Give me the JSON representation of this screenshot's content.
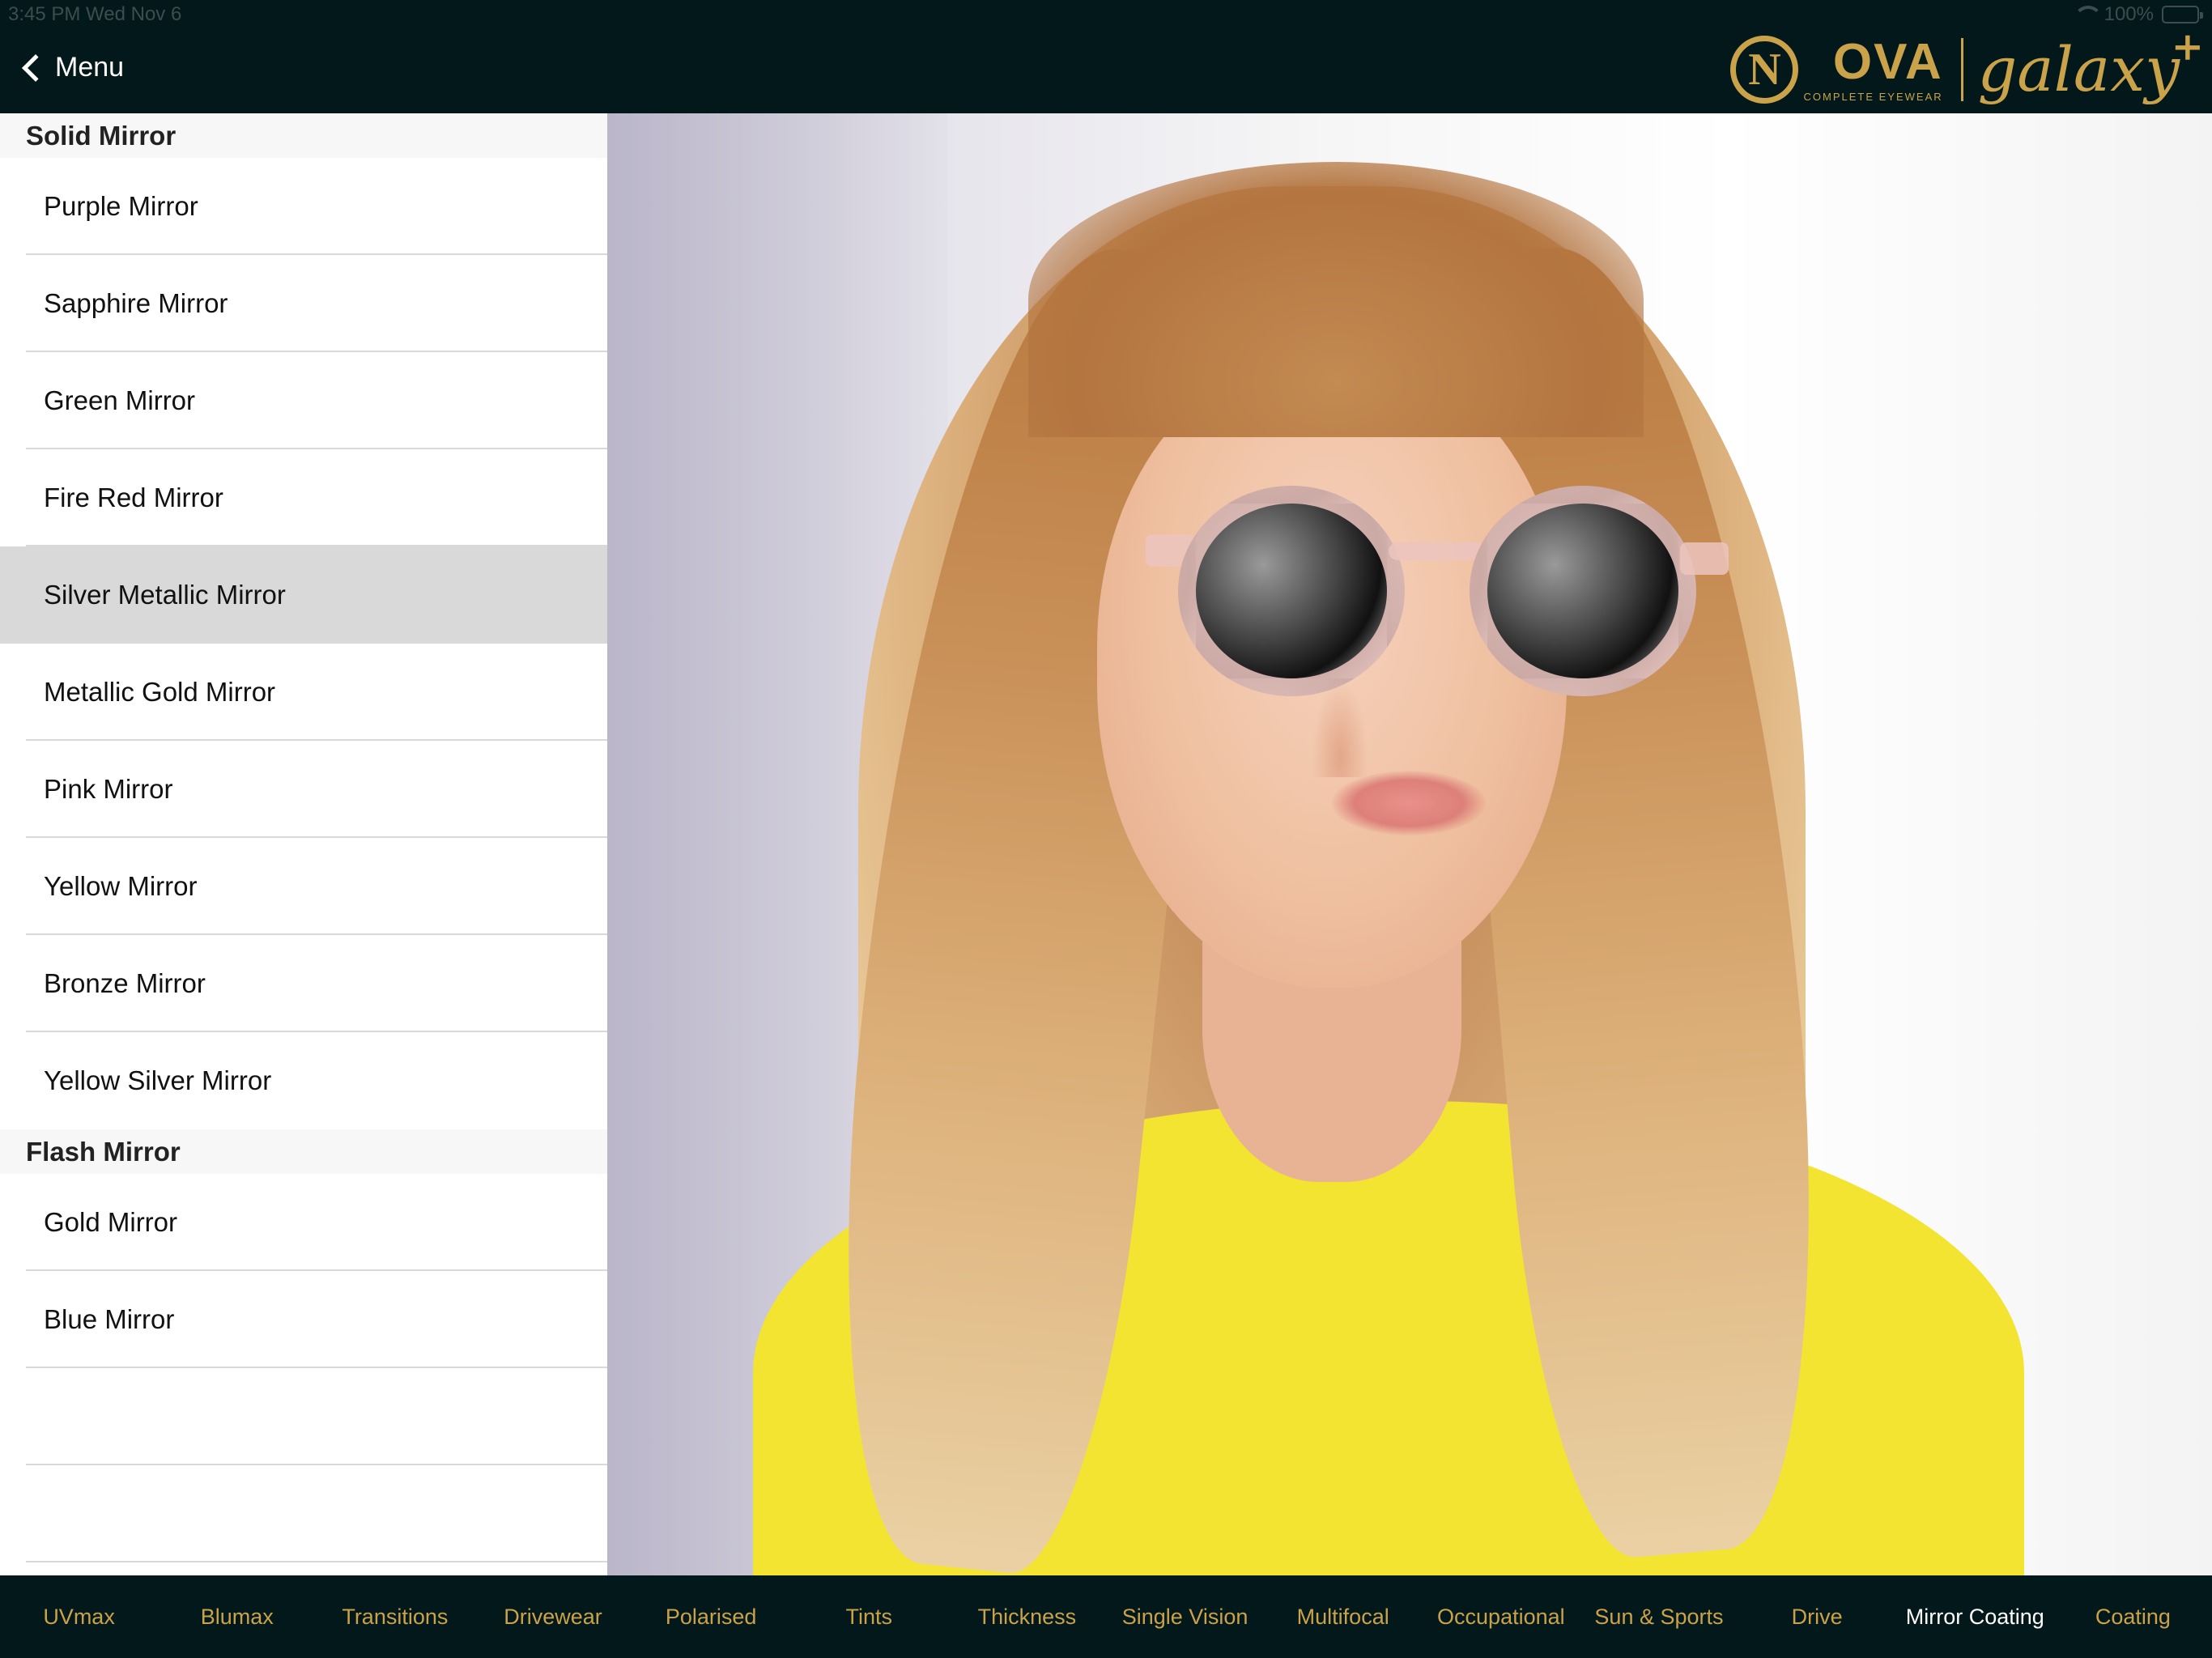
{
  "status_bar": {
    "time_date": "3:45 PM  Wed Nov 6",
    "battery": "100%",
    "battery_level": 1.0
  },
  "nav": {
    "back_label": "Menu"
  },
  "brand": {
    "nova": "OVA",
    "nova_initial": "N",
    "nova_tagline": "COMPLETE EYEWEAR",
    "galaxy": "galaxy",
    "galaxy_plus": "+"
  },
  "colors": {
    "bar_background": "#03181a",
    "accent_gold": "#c9a24a",
    "selected_row": "#d9d9d9"
  },
  "sections": [
    {
      "title": "Solid Mirror",
      "items": [
        "Purple Mirror",
        "Sapphire Mirror",
        "Green Mirror",
        "Fire Red Mirror",
        "Silver Metallic Mirror",
        "Metallic Gold Mirror",
        "Pink Mirror",
        "Yellow Mirror",
        "Bronze Mirror",
        "Yellow Silver Mirror"
      ]
    },
    {
      "title": "Flash Mirror",
      "items": [
        "Gold Mirror",
        "Blue Mirror"
      ]
    }
  ],
  "selected_item": "Silver Metallic Mirror",
  "tabs": [
    "UVmax",
    "Blumax",
    "Transitions",
    "Drivewear",
    "Polarised",
    "Tints",
    "Thickness",
    "Single Vision",
    "Multifocal",
    "Occupational",
    "Sun & Sports",
    "Drive",
    "Mirror Coating",
    "Coating"
  ],
  "active_tab": "Mirror Coating"
}
